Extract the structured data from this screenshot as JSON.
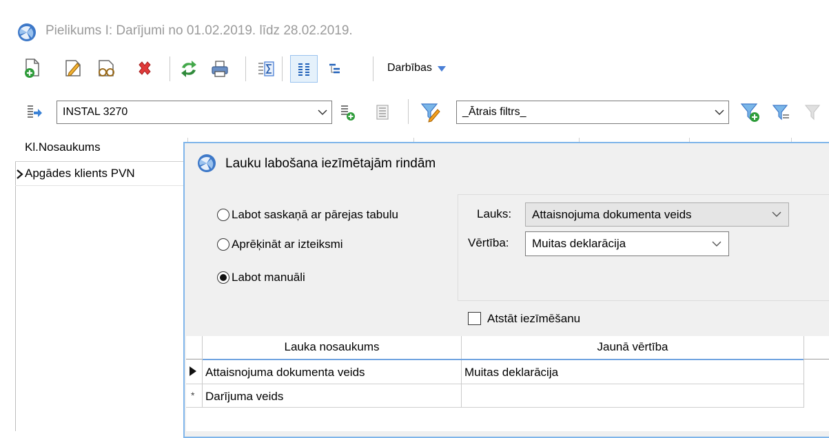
{
  "window": {
    "title": "Pielikums I: Darījumi no 01.02.2019. līdz 28.02.2019."
  },
  "toolbar": {
    "buttons": [
      "new-document-icon",
      "edit-icon",
      "view-icon",
      "delete-icon",
      "refresh-icon",
      "print-icon",
      "sum-icon",
      "columns-icon",
      "tree-icon"
    ],
    "actions_label": "Darbības"
  },
  "selector": {
    "value": "INSTAL 3270"
  },
  "filter": {
    "value": "_Ātrais filtrs_"
  },
  "grid": {
    "column_header": "Kl.Nosaukums",
    "rows": [
      "Apgādes klients PVN"
    ]
  },
  "dialog": {
    "title": "Lauku labošana iezīmētajām rindām",
    "options": [
      {
        "label": "Labot saskaņā ar pārejas tabulu",
        "selected": false
      },
      {
        "label": "Aprēķināt ar izteiksmi",
        "selected": false
      },
      {
        "label": "Labot manuāli",
        "selected": true
      }
    ],
    "field_label": "Lauks:",
    "field_value": "Attaisnojuma dokumenta veids",
    "value_label": "Vērtība:",
    "value_value": "Muitas deklarācija",
    "keep_selection_label": "Atstāt iezīmēšanu",
    "keep_selection_checked": false,
    "edit_grid": {
      "headers": [
        "Lauka nosaukums",
        "Jaunā vērtība"
      ],
      "rows": [
        {
          "marker": "▶",
          "field": "Attaisnojuma dokumenta veids",
          "value": "Muitas deklarācija"
        },
        {
          "marker": "*",
          "field": "Darījuma veids",
          "value": ""
        }
      ]
    }
  }
}
